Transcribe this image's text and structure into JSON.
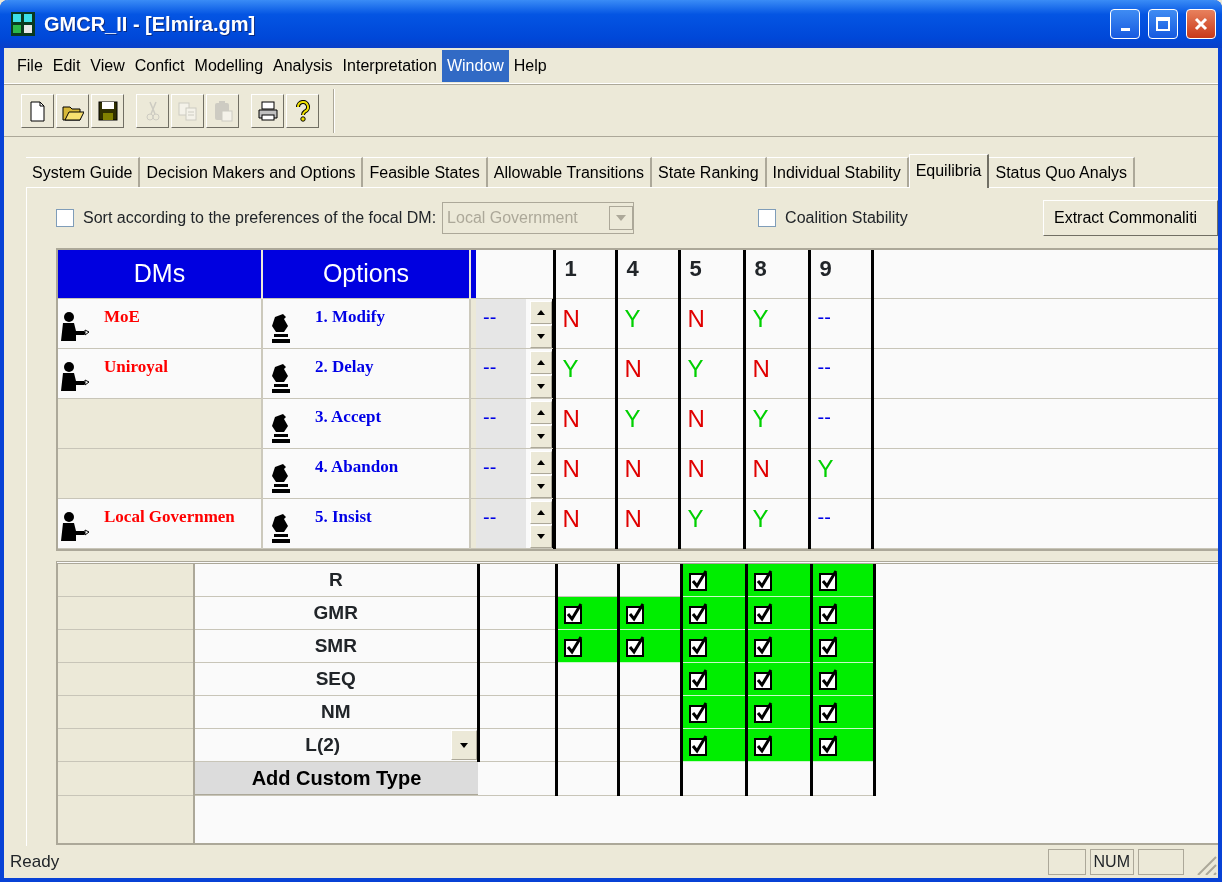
{
  "window": {
    "title": "GMCR_II - [Elmira.gm]"
  },
  "menu": [
    {
      "label": "File",
      "selected": false
    },
    {
      "label": "Edit",
      "selected": false
    },
    {
      "label": "View",
      "selected": false
    },
    {
      "label": "Confict",
      "selected": false
    },
    {
      "label": "Modelling",
      "selected": false
    },
    {
      "label": "Analysis",
      "selected": false
    },
    {
      "label": "Interpretation",
      "selected": false
    },
    {
      "label": "Window",
      "selected": true
    },
    {
      "label": "Help",
      "selected": false
    }
  ],
  "toolbar": [
    [
      {
        "kind": "new",
        "disabled": false
      },
      {
        "kind": "open",
        "disabled": false
      },
      {
        "kind": "save",
        "disabled": false
      }
    ],
    [
      {
        "kind": "cut",
        "disabled": true
      },
      {
        "kind": "copy",
        "disabled": true
      },
      {
        "kind": "paste",
        "disabled": true
      }
    ],
    [
      {
        "kind": "print",
        "disabled": false
      },
      {
        "kind": "help",
        "disabled": false
      }
    ]
  ],
  "tabs": [
    {
      "label": "System Guide",
      "selected": false
    },
    {
      "label": "Decision Makers and Options",
      "selected": false
    },
    {
      "label": "Feasible States",
      "selected": false
    },
    {
      "label": "Allowable Transitions",
      "selected": false
    },
    {
      "label": "State Ranking",
      "selected": false
    },
    {
      "label": "Individual Stability",
      "selected": false
    },
    {
      "label": "Equilibria",
      "selected": true
    },
    {
      "label": "Status Quo Analys",
      "selected": false
    }
  ],
  "controls": {
    "sort": {
      "label": "Sort according to the preferences of the focal DM:",
      "checked": false
    },
    "focal_dm": {
      "value": "Local Government",
      "disabled": true
    },
    "coalition": {
      "label": "Coalition Stability",
      "checked": false
    },
    "extract_button": "Extract Commonaliti"
  },
  "options_table": {
    "headers": [
      "DMs",
      "Options"
    ],
    "states": [
      "1",
      "4",
      "5",
      "8",
      "9"
    ],
    "rows": [
      {
        "dm": "MoE",
        "option": "1. Modify",
        "value": {
          "text": "--",
          "kind": "any"
        },
        "cells": [
          {
            "text": "N",
            "kind": "no"
          },
          {
            "text": "Y",
            "kind": "yes"
          },
          {
            "text": "N",
            "kind": "no"
          },
          {
            "text": "Y",
            "kind": "yes"
          },
          {
            "text": "--",
            "kind": "any"
          }
        ]
      },
      {
        "dm": "Uniroyal",
        "option": "2. Delay",
        "value": {
          "text": "--",
          "kind": "any"
        },
        "cells": [
          {
            "text": "Y",
            "kind": "yes"
          },
          {
            "text": "N",
            "kind": "no"
          },
          {
            "text": "Y",
            "kind": "yes"
          },
          {
            "text": "N",
            "kind": "no"
          },
          {
            "text": "--",
            "kind": "any"
          }
        ]
      },
      {
        "option": "3. Accept",
        "value": {
          "text": "--",
          "kind": "any"
        },
        "cells": [
          {
            "text": "N",
            "kind": "no"
          },
          {
            "text": "Y",
            "kind": "yes"
          },
          {
            "text": "N",
            "kind": "no"
          },
          {
            "text": "Y",
            "kind": "yes"
          },
          {
            "text": "--",
            "kind": "any"
          }
        ]
      },
      {
        "option": "4. Abandon",
        "value": {
          "text": "--",
          "kind": "any"
        },
        "cells": [
          {
            "text": "N",
            "kind": "no"
          },
          {
            "text": "N",
            "kind": "no"
          },
          {
            "text": "N",
            "kind": "no"
          },
          {
            "text": "N",
            "kind": "no"
          },
          {
            "text": "Y",
            "kind": "yes"
          }
        ]
      },
      {
        "dm": "Local Governmen",
        "option": "5. Insist",
        "value": {
          "text": "--",
          "kind": "any"
        },
        "cells": [
          {
            "text": "N",
            "kind": "no"
          },
          {
            "text": "N",
            "kind": "no"
          },
          {
            "text": "Y",
            "kind": "yes"
          },
          {
            "text": "Y",
            "kind": "yes"
          },
          {
            "text": "--",
            "kind": "any"
          }
        ]
      }
    ]
  },
  "stability": {
    "rows": [
      {
        "label": "R",
        "kind": "plain",
        "checks": [
          false,
          false,
          true,
          true,
          true
        ]
      },
      {
        "label": "GMR",
        "kind": "plain",
        "checks": [
          true,
          true,
          true,
          true,
          true
        ]
      },
      {
        "label": "SMR",
        "kind": "plain",
        "checks": [
          true,
          true,
          true,
          true,
          true
        ]
      },
      {
        "label": "SEQ",
        "kind": "plain",
        "checks": [
          false,
          false,
          true,
          true,
          true
        ]
      },
      {
        "label": "NM",
        "kind": "plain",
        "checks": [
          false,
          false,
          true,
          true,
          true
        ]
      },
      {
        "label": "L(2)",
        "kind": "dropdown",
        "checks": [
          false,
          false,
          true,
          true,
          true
        ]
      }
    ],
    "add_button": "Add Custom Type"
  },
  "status_bar": {
    "text": "Ready",
    "indicator": "NUM"
  }
}
